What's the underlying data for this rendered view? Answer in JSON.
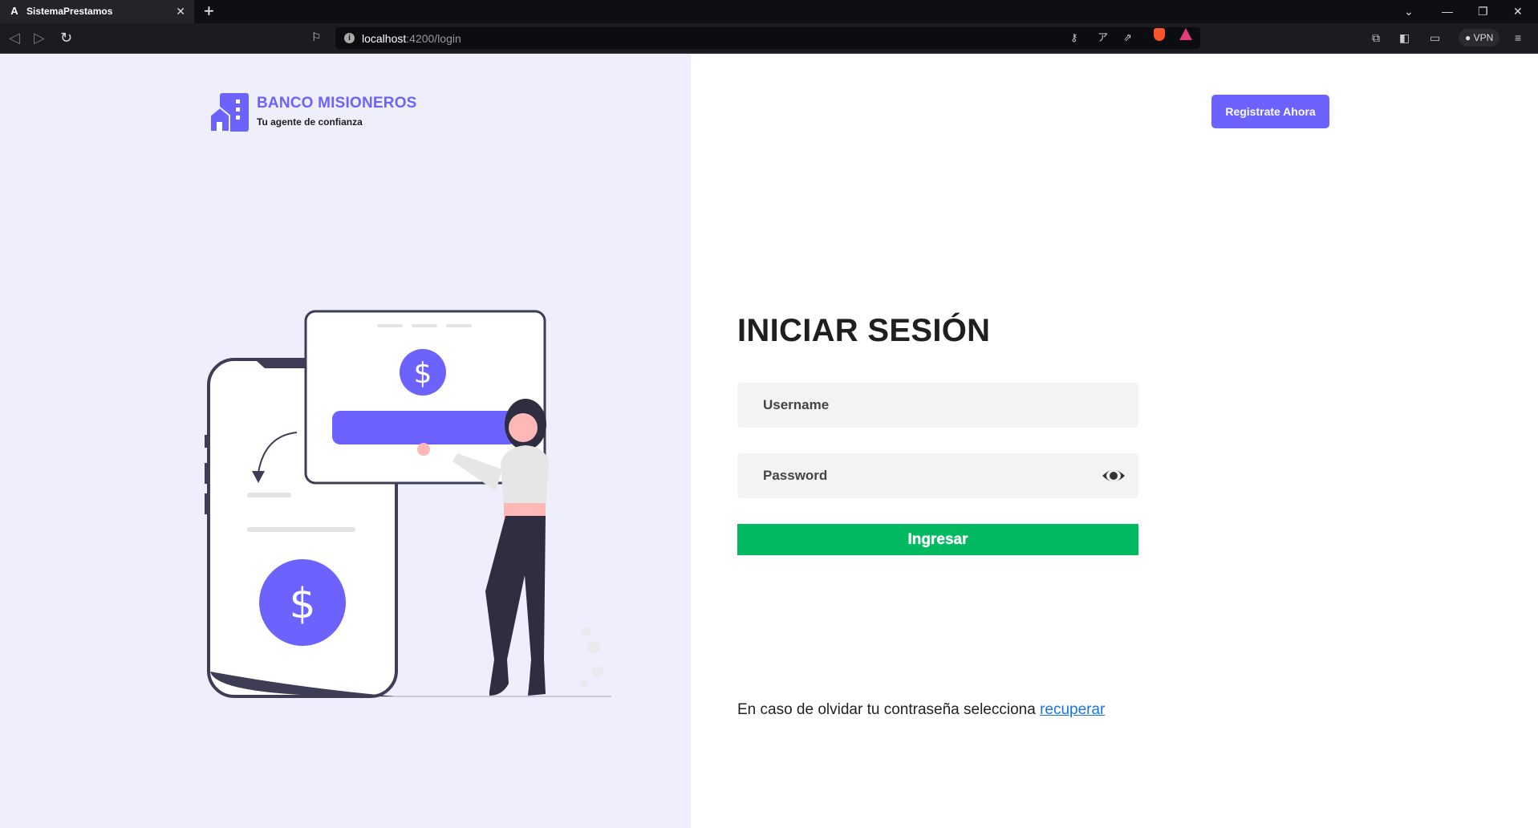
{
  "browser": {
    "tab": {
      "title": "SistemaPrestamos",
      "favicon": "A"
    },
    "url": {
      "host": "localhost",
      "rest": ":4200/login"
    },
    "vpn_label": "VPN"
  },
  "brand": {
    "name": "BANCO MISIONEROS",
    "tagline": "Tu agente de confianza",
    "accent_color": "#6c63ff"
  },
  "header": {
    "register_label": "Registrate Ahora"
  },
  "login": {
    "title": "INICIAR SESIÓN",
    "username_placeholder": "Username",
    "password_placeholder": "Password",
    "submit_label": "Ingresar",
    "submit_color": "#00b961",
    "recover_text": "En caso de olvidar tu contraseña selecciona",
    "recover_link": "recuperar"
  },
  "illustration": {
    "currency_symbol": "$",
    "icon": "mobile-payment-illustration"
  }
}
